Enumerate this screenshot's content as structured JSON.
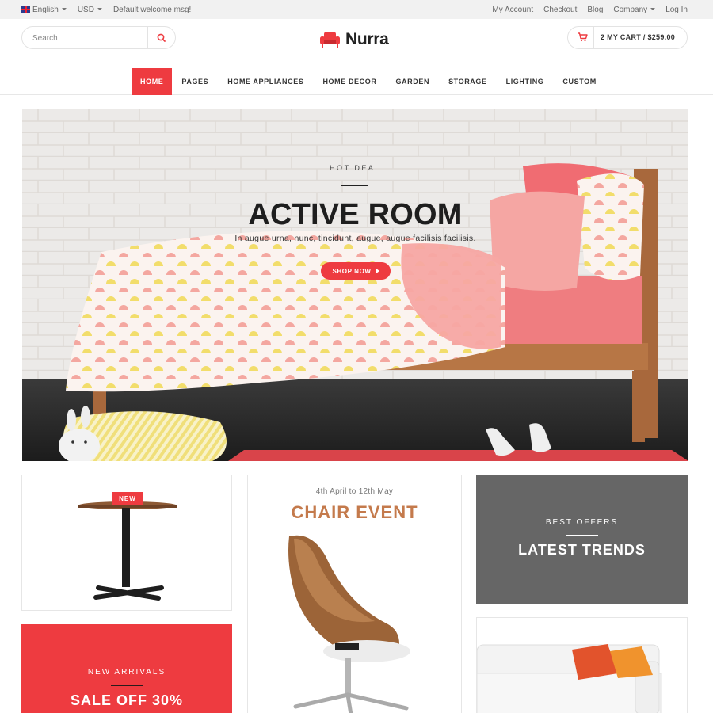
{
  "topbar": {
    "language": "English",
    "currency": "USD",
    "welcome": "Default welcome msg!",
    "links": {
      "account": "My Account",
      "checkout": "Checkout",
      "blog": "Blog",
      "company": "Company",
      "login": "Log In"
    }
  },
  "header": {
    "search_placeholder": "Search",
    "logo_text": "Nurra",
    "cart_text": "2 MY CART / $259.00"
  },
  "nav": {
    "items": [
      "HOME",
      "PAGES",
      "HOME APPLIANCES",
      "HOME DECOR",
      "GARDEN",
      "STORAGE",
      "LIGHTING",
      "CUSTOM"
    ],
    "active_index": 0
  },
  "hero": {
    "kicker": "HOT DEAL",
    "title": "ACTIVE ROOM",
    "subtitle": "In augue urna, nunc, tincidunt, augue, augue facilisis facilisis.",
    "cta": "SHOP NOW"
  },
  "banners": {
    "table_badge": "NEW",
    "sale_kicker": "NEW ARRIVALS",
    "sale_title": "SALE OFF 30%",
    "chair_date": "4th April to 12th May",
    "chair_title": "CHAIR EVENT",
    "trend_kicker": "BEST OFFERS",
    "trend_title": "LATEST TRENDS"
  },
  "colors": {
    "accent": "#ee3b40",
    "dark_panel": "#666666",
    "chair_title": "#c47a4c"
  },
  "icons": {
    "search": "search-icon",
    "cart": "cart-icon",
    "logo": "armchair-icon",
    "caret": "chevron-down-icon",
    "cta_arrow": "arrow-right-icon"
  }
}
